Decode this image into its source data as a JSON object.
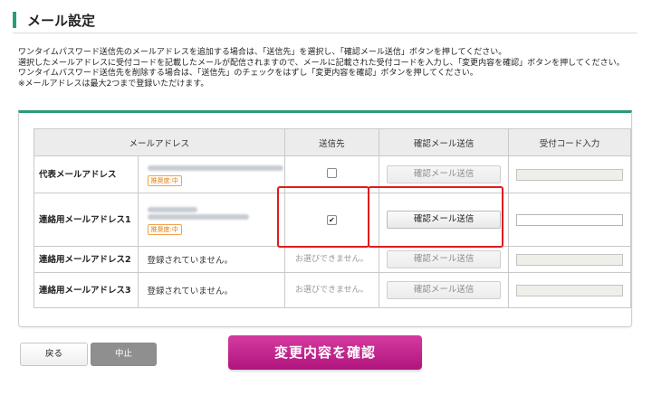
{
  "page": {
    "title": "メール設定",
    "description": [
      "ワンタイムパスワード送信先のメールアドレスを追加する場合は、「送信先」を選択し、「確認メール送信」ボタンを押してください。",
      "選択したメールアドレスに受付コードを記載したメールが配信されますので、メールに記載された受付コードを入力し、「変更内容を確認」ボタンを押してください。",
      "ワンタイムパスワード送信先を削除する場合は、「送信先」のチェックをはずし「変更内容を確認」ボタンを押してください。",
      "※メールアドレスは最大2つまで登録いただけます。"
    ]
  },
  "table": {
    "headers": [
      "メールアドレス",
      "送信先",
      "確認メール送信",
      "受付コード入力"
    ],
    "rows": [
      {
        "label": "代表メールアドレス",
        "email_blurred": true,
        "badge": "推奨度:中",
        "checked": false,
        "selectable": true,
        "send_button": "確認メール送信",
        "send_enabled": false,
        "code_enabled": false
      },
      {
        "label": "連絡用メールアドレス1",
        "email_blurred": true,
        "badge": "推奨度:中",
        "checked": true,
        "selectable": true,
        "send_button": "確認メール送信",
        "send_enabled": true,
        "code_enabled": true
      },
      {
        "label": "連絡用メールアドレス2",
        "email_text": "登録されていません。",
        "not_selectable_text": "お選びできません。",
        "send_button": "確認メール送信",
        "send_enabled": false,
        "code_enabled": false
      },
      {
        "label": "連絡用メールアドレス3",
        "email_text": "登録されていません。",
        "not_selectable_text": "お選びできません。",
        "send_button": "確認メール送信",
        "send_enabled": false,
        "code_enabled": false
      }
    ]
  },
  "buttons": {
    "back": "戻る",
    "cancel": "中止",
    "confirm": "変更内容を確認"
  },
  "colors": {
    "accent": "#2b9b78",
    "confirm": "#c2268f",
    "highlight": "#e01b1b"
  }
}
